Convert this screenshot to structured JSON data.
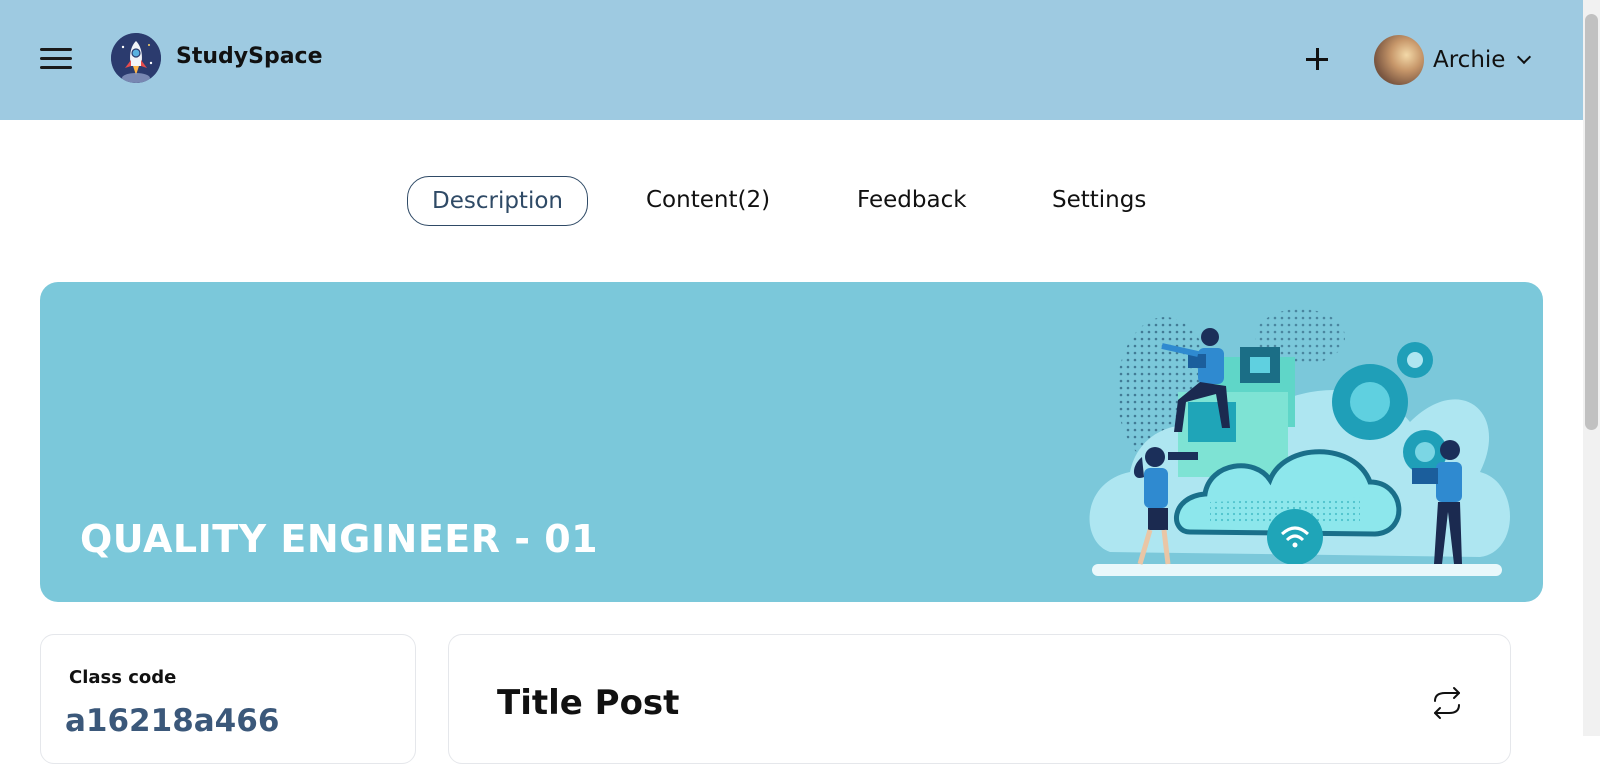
{
  "header": {
    "brand": "StudySpace",
    "user_name": "Archie",
    "menu_icon": "hamburger-menu-icon",
    "add_icon": "plus-icon",
    "logo_icon": "rocket-logo-icon"
  },
  "tabs": [
    {
      "label": "Description",
      "active": true
    },
    {
      "label": "Content(2)",
      "active": false
    },
    {
      "label": "Feedback",
      "active": false
    },
    {
      "label": "Settings",
      "active": false
    }
  ],
  "banner": {
    "title": "QUALITY ENGINEER - 01",
    "color": "#7bc8da",
    "illustration": "cloud-collaboration-illustration"
  },
  "class_card": {
    "label": "Class code",
    "code": "a16218a466"
  },
  "post_card": {
    "title": "Title Post",
    "action_icon": "repeat-icon"
  },
  "colors": {
    "topbar": "#9ecae1",
    "accent": "#2f4a66",
    "code": "#3b587a"
  }
}
